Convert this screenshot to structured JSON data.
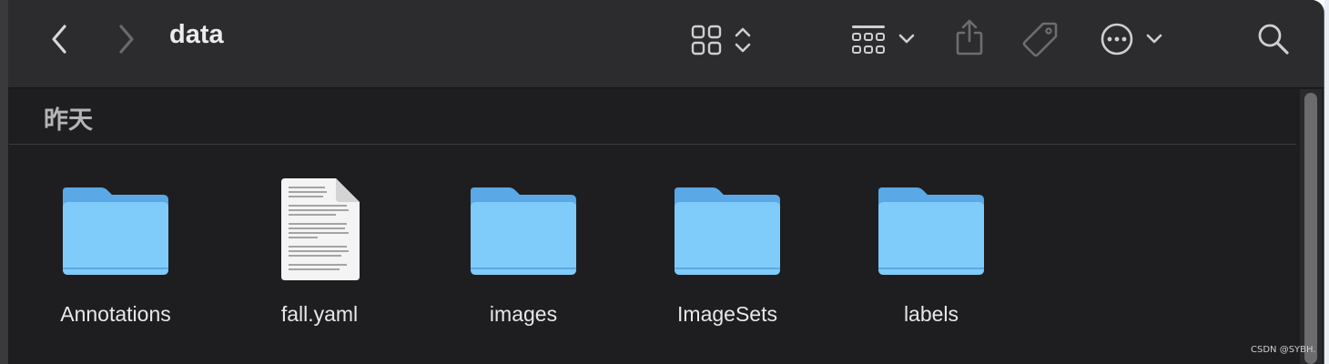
{
  "window": {
    "title": "data",
    "toolbar": {
      "back_icon": "chevron-left-icon",
      "forward_icon": "chevron-right-icon",
      "view_icon": "grid-view-icon",
      "group_icon": "group-by-icon",
      "share_icon": "share-icon",
      "tag_icon": "tag-icon",
      "more_icon": "ellipsis-circle-icon",
      "search_icon": "search-icon"
    }
  },
  "section": {
    "header": "昨天"
  },
  "items": [
    {
      "name": "Annotations",
      "kind": "folder"
    },
    {
      "name": "fall.yaml",
      "kind": "document"
    },
    {
      "name": "images",
      "kind": "folder"
    },
    {
      "name": "ImageSets",
      "kind": "folder"
    },
    {
      "name": "labels",
      "kind": "folder"
    }
  ],
  "colors": {
    "folder": "#6ebcf3",
    "folder_front": "#7fcbfa",
    "window_bg": "#1e1e20",
    "toolbar_bg": "#2c2c2e"
  },
  "watermark": "CSDN @SYBH."
}
